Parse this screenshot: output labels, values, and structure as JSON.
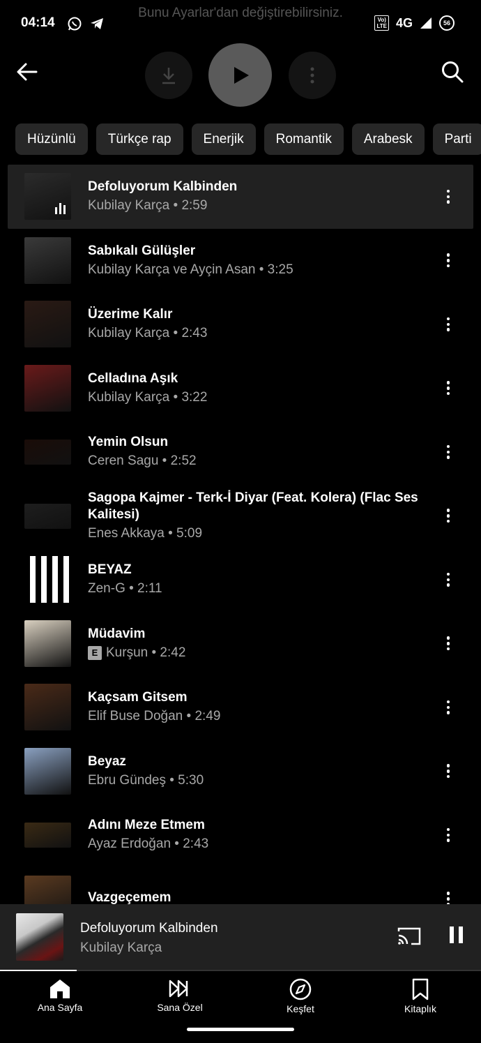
{
  "banner": {
    "text": "Bunu Ayarlar'dan değiştirebilirsiniz."
  },
  "status": {
    "time": "04:14",
    "volte_top": "Vo)",
    "volte_bottom": "LTE",
    "network": "4G",
    "battery": "56"
  },
  "chips": [
    "Hüzünlü",
    "Türkçe rap",
    "Enerjik",
    "Romantik",
    "Arabesk",
    "Parti"
  ],
  "songs": [
    {
      "title": "Defoluyorum Kalbinden",
      "meta": "Kubilay Karça • 2:59",
      "explicit": false,
      "playing": true
    },
    {
      "title": "Sabıkalı Gülüşler",
      "meta": "Kubilay Karça ve Ayçin Asan • 3:25",
      "explicit": false
    },
    {
      "title": "Üzerime Kalır",
      "meta": "Kubilay Karça • 2:43",
      "explicit": false
    },
    {
      "title": "Celladına Aşık",
      "meta": "Kubilay Karça • 3:22",
      "explicit": false
    },
    {
      "title": "Yemin Olsun",
      "meta": "Ceren Sagu • 2:52",
      "explicit": false
    },
    {
      "title": "Sagopa Kajmer - Terk-İ Diyar (Feat. Kolera) (Flac Ses Kalitesi)",
      "meta": "Enes Akkaya • 5:09",
      "explicit": false
    },
    {
      "title": "BEYAZ",
      "meta": "Zen-G • 2:11",
      "explicit": false
    },
    {
      "title": "Müdavim",
      "meta": "Kurşun • 2:42",
      "explicit": true,
      "explicit_label": "E"
    },
    {
      "title": "Kaçsam Gitsem",
      "meta": "Elif Buse Doğan • 2:49",
      "explicit": false
    },
    {
      "title": "Beyaz",
      "meta": "Ebru Gündeş • 5:30",
      "explicit": false
    },
    {
      "title": "Adını Meze Etmem",
      "meta": "Ayaz Erdoğan • 2:43",
      "explicit": false
    },
    {
      "title": "Vazgeçemem",
      "meta": "",
      "explicit": false
    }
  ],
  "mini_player": {
    "title": "Defoluyorum Kalbinden",
    "artist": "Kubilay Karça",
    "progress": 0.16
  },
  "nav": [
    {
      "label": "Ana Sayfa",
      "icon": "home-icon",
      "active": true
    },
    {
      "label": "Sana Özel",
      "icon": "samples-icon"
    },
    {
      "label": "Keşfet",
      "icon": "explore-icon"
    },
    {
      "label": "Kitaplık",
      "icon": "library-icon"
    }
  ],
  "thumb_colors": [
    "#2b2b2b",
    "#3a3a3a",
    "#2a1a14",
    "#6a1a1a",
    "#1a0c08",
    "#1e1e1e",
    "#ffffff",
    "#d9d0c0",
    "#4a2a18",
    "#8aa0c0",
    "#3a2a14",
    "#5a3a20"
  ]
}
